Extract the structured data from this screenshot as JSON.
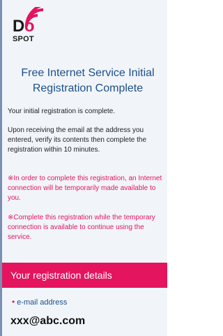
{
  "logo": {
    "do": "Do",
    "spot": "SPOT"
  },
  "page_title": "Free Internet Service Initial Registration Complete",
  "paragraphs": [
    "Your initial registration is complete.",
    "Upon receiving the email at the address you entered, verify its contents then complete the registration within 10 minutes."
  ],
  "notes": [
    "※In order to complete this registration, an Internet connection will be temporarily made available to you.",
    "※Complete this registration while the temporary connection is available to continue using the service."
  ],
  "section": {
    "title": "Your registration details"
  },
  "fields": [
    {
      "bullet": "•",
      "label": "e-mail address",
      "value": "xxx@abc.com"
    }
  ],
  "colors": {
    "brand_pink": "#e5145f",
    "title_blue": "#1c4f8a",
    "background": "#f1f5f9"
  }
}
